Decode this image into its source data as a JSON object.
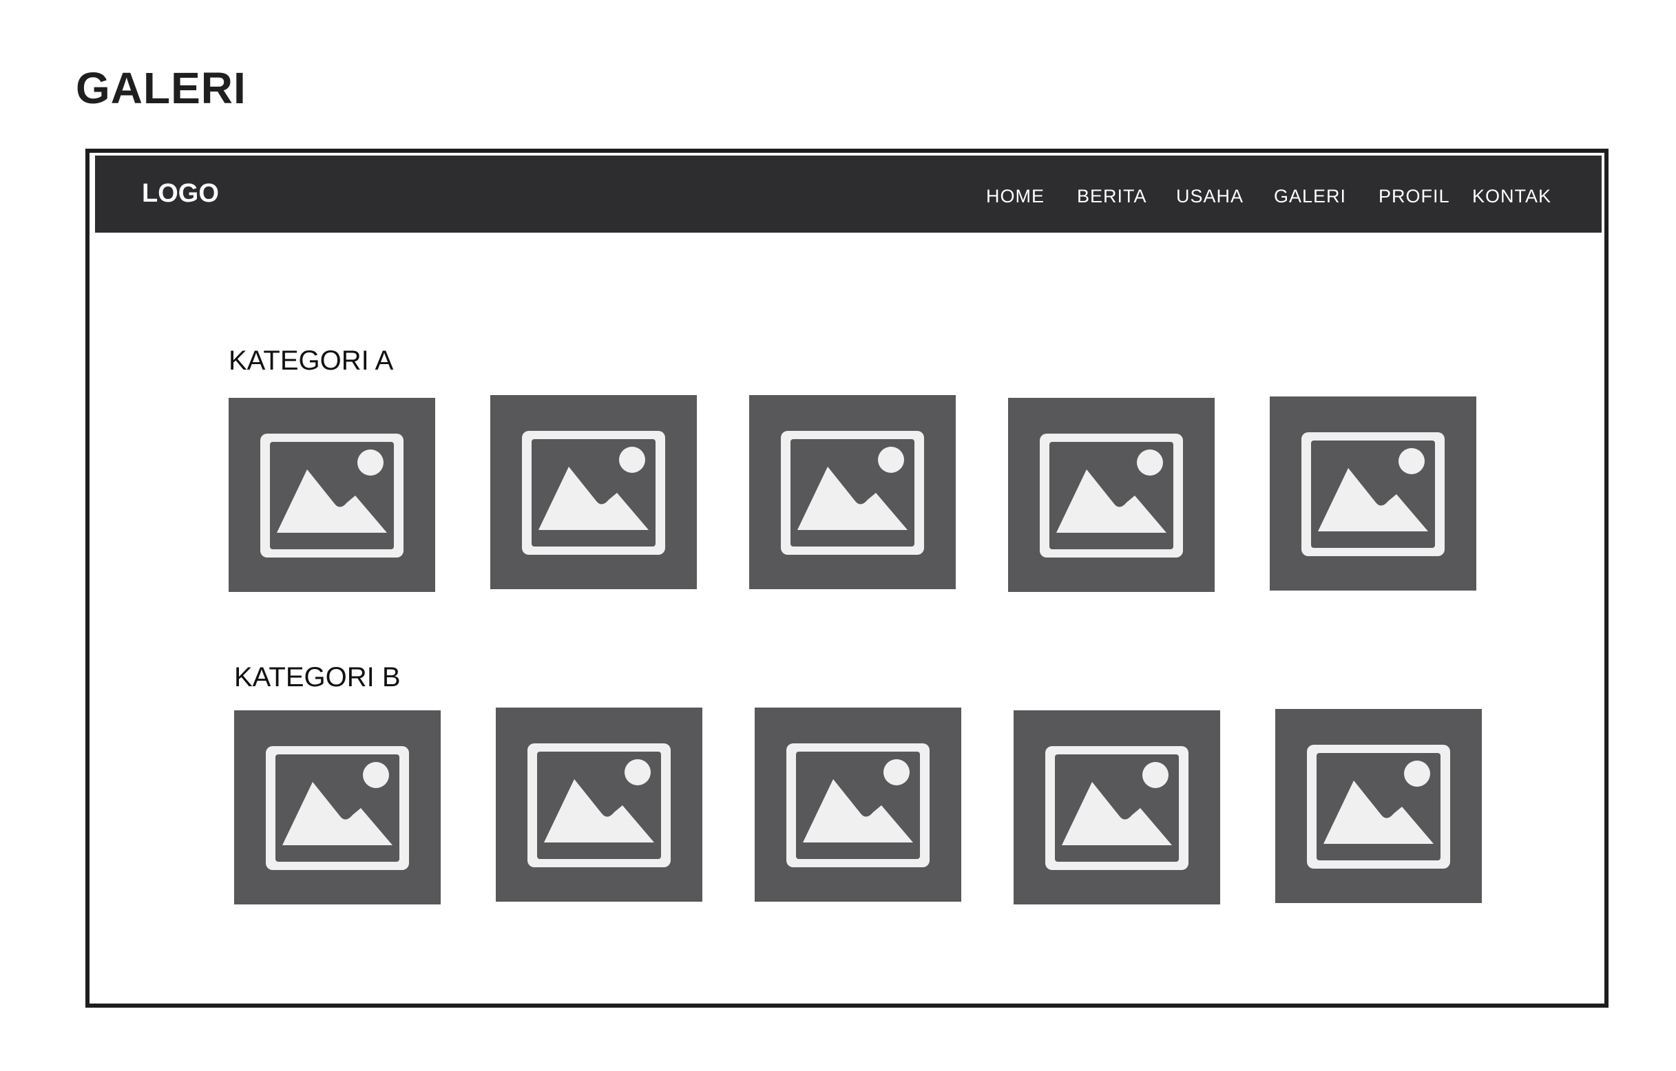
{
  "page": {
    "title": "GALERI"
  },
  "navbar": {
    "logo": "LOGO",
    "items": [
      {
        "label": "HOME"
      },
      {
        "label": "BERITA"
      },
      {
        "label": "USAHA"
      },
      {
        "label": "GALERI"
      },
      {
        "label": "PROFIL"
      },
      {
        "label": "KONTAK"
      }
    ]
  },
  "categories": [
    {
      "label": "KATEGORI A",
      "images": [
        "image-icon",
        "image-icon",
        "image-icon",
        "image-icon",
        "image-icon"
      ]
    },
    {
      "label": "KATEGORI B",
      "images": [
        "image-icon",
        "image-icon",
        "image-icon",
        "image-icon",
        "image-icon"
      ]
    }
  ],
  "colors": {
    "navbar_bg": "#2d2d2f",
    "thumb_bg": "#58585a",
    "icon_fg": "#f0f0f0",
    "frame_border": "#1e1e1e"
  }
}
